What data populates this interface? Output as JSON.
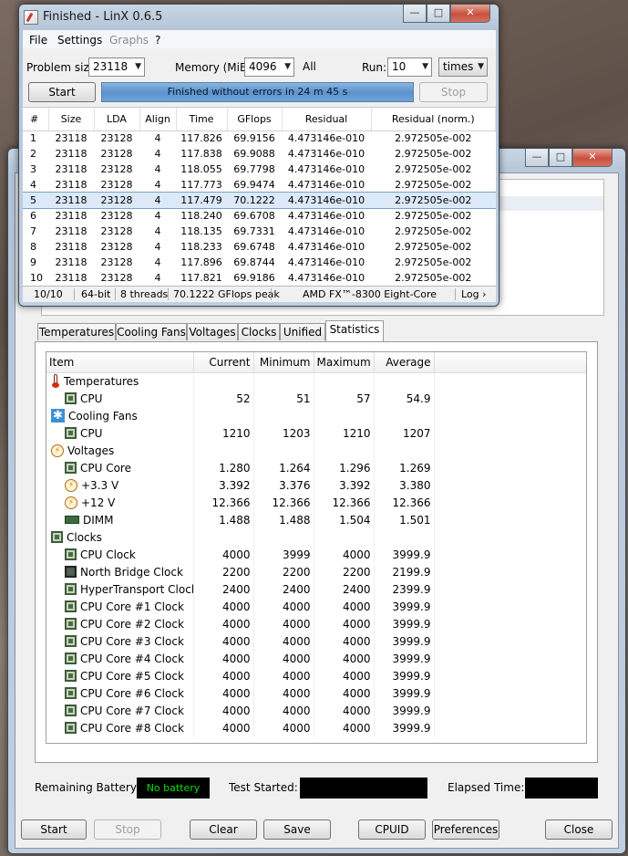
{
  "hwmon": {
    "tabs": [
      "Temperatures",
      "Cooling Fans",
      "Voltages",
      "Clocks",
      "Unified",
      "Statistics"
    ],
    "columns": [
      "Item",
      "Current",
      "Minimum",
      "Maximum",
      "Average"
    ],
    "rows": [
      {
        "kind": "group",
        "icon": "thermometer-icon",
        "name": "Temperatures"
      },
      {
        "kind": "item",
        "icon": "chip-icon",
        "name": "CPU",
        "current": "52",
        "min": "51",
        "max": "57",
        "avg": "54.9"
      },
      {
        "kind": "group",
        "icon": "fan-icon",
        "name": "Cooling Fans"
      },
      {
        "kind": "item",
        "icon": "chip-icon",
        "name": "CPU",
        "current": "1210",
        "min": "1203",
        "max": "1210",
        "avg": "1207"
      },
      {
        "kind": "group",
        "icon": "bolt-icon",
        "name": "Voltages"
      },
      {
        "kind": "item",
        "icon": "chip-icon",
        "name": "CPU Core",
        "current": "1.280",
        "min": "1.264",
        "max": "1.296",
        "avg": "1.269"
      },
      {
        "kind": "item",
        "icon": "bolt-icon",
        "name": "+3.3 V",
        "current": "3.392",
        "min": "3.376",
        "max": "3.392",
        "avg": "3.380"
      },
      {
        "kind": "item",
        "icon": "bolt-icon",
        "name": "+12 V",
        "current": "12.366",
        "min": "12.366",
        "max": "12.366",
        "avg": "12.366"
      },
      {
        "kind": "item",
        "icon": "dimm-icon",
        "name": "DIMM",
        "current": "1.488",
        "min": "1.488",
        "max": "1.504",
        "avg": "1.501"
      },
      {
        "kind": "group",
        "icon": "clock-chip-icon",
        "name": "Clocks"
      },
      {
        "kind": "item",
        "icon": "chip-icon",
        "name": "CPU Clock",
        "current": "4000",
        "min": "3999",
        "max": "4000",
        "avg": "3999.9"
      },
      {
        "kind": "item",
        "icon": "northbridge-icon",
        "name": "North Bridge Clock",
        "current": "2200",
        "min": "2200",
        "max": "2200",
        "avg": "2199.9"
      },
      {
        "kind": "item",
        "icon": "chip-icon",
        "name": "HyperTransport Clock",
        "current": "2400",
        "min": "2400",
        "max": "2400",
        "avg": "2399.9"
      },
      {
        "kind": "item",
        "icon": "chip-icon",
        "name": "CPU Core #1 Clock",
        "current": "4000",
        "min": "4000",
        "max": "4000",
        "avg": "3999.9"
      },
      {
        "kind": "item",
        "icon": "chip-icon",
        "name": "CPU Core #2 Clock",
        "current": "4000",
        "min": "4000",
        "max": "4000",
        "avg": "3999.9"
      },
      {
        "kind": "item",
        "icon": "chip-icon",
        "name": "CPU Core #3 Clock",
        "current": "4000",
        "min": "4000",
        "max": "4000",
        "avg": "3999.9"
      },
      {
        "kind": "item",
        "icon": "chip-icon",
        "name": "CPU Core #4 Clock",
        "current": "4000",
        "min": "4000",
        "max": "4000",
        "avg": "3999.9"
      },
      {
        "kind": "item",
        "icon": "chip-icon",
        "name": "CPU Core #5 Clock",
        "current": "4000",
        "min": "4000",
        "max": "4000",
        "avg": "3999.9"
      },
      {
        "kind": "item",
        "icon": "chip-icon",
        "name": "CPU Core #6 Clock",
        "current": "4000",
        "min": "4000",
        "max": "4000",
        "avg": "3999.9"
      },
      {
        "kind": "item",
        "icon": "chip-icon",
        "name": "CPU Core #7 Clock",
        "current": "4000",
        "min": "4000",
        "max": "4000",
        "avg": "3999.9"
      },
      {
        "kind": "item",
        "icon": "chip-icon",
        "name": "CPU Core #8 Clock",
        "current": "4000",
        "min": "4000",
        "max": "4000",
        "avg": "3999.9"
      }
    ],
    "battery_label": "Remaining Battery:",
    "battery_value": "No battery",
    "test_started_label": "Test Started:",
    "elapsed_label": "Elapsed Time:",
    "buttons": {
      "start": "Start",
      "stop": "Stop",
      "clear": "Clear",
      "save": "Save",
      "cpuid": "CPUID",
      "preferences": "Preferences",
      "close": "Close"
    }
  },
  "linx": {
    "title": "Finished - LinX 0.6.5",
    "menu": [
      "File",
      "Settings",
      "Graphs",
      "?"
    ],
    "problem_size_label": "Problem size:",
    "problem_size": "23118",
    "memory_label": "Memory (MiB):",
    "memory": "4096",
    "all_label": "All",
    "run_label": "Run:",
    "run": "10",
    "run_unit": "times",
    "start": "Start",
    "stop": "Stop",
    "status": "Finished without errors in 24 m 45 s",
    "columns": [
      "#",
      "Size",
      "LDA",
      "Align",
      "Time",
      "GFlops",
      "Residual",
      "Residual (norm.)"
    ],
    "results": [
      [
        "1",
        "23118",
        "23128",
        "4",
        "117.826",
        "69.9156",
        "4.473146e-010",
        "2.972505e-002"
      ],
      [
        "2",
        "23118",
        "23128",
        "4",
        "117.838",
        "69.9088",
        "4.473146e-010",
        "2.972505e-002"
      ],
      [
        "3",
        "23118",
        "23128",
        "4",
        "118.055",
        "69.7798",
        "4.473146e-010",
        "2.972505e-002"
      ],
      [
        "4",
        "23118",
        "23128",
        "4",
        "117.773",
        "69.9474",
        "4.473146e-010",
        "2.972505e-002"
      ],
      [
        "5",
        "23118",
        "23128",
        "4",
        "117.479",
        "70.1222",
        "4.473146e-010",
        "2.972505e-002"
      ],
      [
        "6",
        "23118",
        "23128",
        "4",
        "118.240",
        "69.6708",
        "4.473146e-010",
        "2.972505e-002"
      ],
      [
        "7",
        "23118",
        "23128",
        "4",
        "118.135",
        "69.7331",
        "4.473146e-010",
        "2.972505e-002"
      ],
      [
        "8",
        "23118",
        "23128",
        "4",
        "118.233",
        "69.6748",
        "4.473146e-010",
        "2.972505e-002"
      ],
      [
        "9",
        "23118",
        "23128",
        "4",
        "117.896",
        "69.8744",
        "4.473146e-010",
        "2.972505e-002"
      ],
      [
        "10",
        "23118",
        "23128",
        "4",
        "117.821",
        "69.9186",
        "4.473146e-010",
        "2.972505e-002"
      ]
    ],
    "selected_row": 4,
    "statusbar": {
      "runs": "10/10",
      "bits": "64-bit",
      "threads": "8 threads",
      "peak": "70.1222 GFlops peak",
      "cpu": "AMD FX™-8300 Eight-Core",
      "log": "Log ›"
    }
  }
}
